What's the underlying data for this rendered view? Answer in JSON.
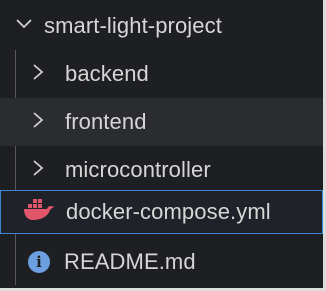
{
  "explorer": {
    "root": {
      "label": "smart-light-project",
      "expanded": true,
      "icon": "chevron-down-icon"
    },
    "items": [
      {
        "label": "backend",
        "type": "folder",
        "expanded": false,
        "icon": "chevron-right-icon"
      },
      {
        "label": "frontend",
        "type": "folder",
        "expanded": false,
        "icon": "chevron-right-icon"
      },
      {
        "label": "microcontroller",
        "type": "folder",
        "expanded": false,
        "icon": "chevron-right-icon"
      },
      {
        "label": "docker-compose.yml",
        "type": "file",
        "icon": "docker-whale-icon",
        "selected": true
      },
      {
        "label": "README.md",
        "type": "file",
        "icon": "info-icon"
      }
    ]
  },
  "colors": {
    "background": "#1e1f22",
    "hover_row": "#2a2c30",
    "selection_border": "#3c86d6",
    "docker_icon": "#e0556a",
    "info_icon": "#6b9fe0",
    "text": "#d6d6d6"
  }
}
